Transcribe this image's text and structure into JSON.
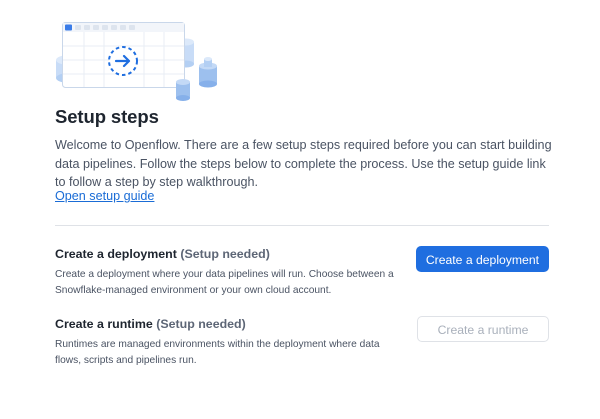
{
  "header": {
    "title": "Setup steps",
    "intro": "Welcome to Openflow. There are a few setup steps required before you can start building data pipelines. Follow the steps below to complete the process. Use the setup guide link to follow a step by step walkthrough.",
    "guide_link": "Open setup guide"
  },
  "illustration": {
    "icons": [
      "browser-window-icon",
      "arrow-right-icon",
      "database-icon"
    ],
    "colors": {
      "accent": "#1f6ee0",
      "light_blue": "#c8dcf7",
      "mid_blue": "#9dc0ee"
    }
  },
  "steps": [
    {
      "title": "Create a deployment",
      "status": "(Setup needed)",
      "description": "Create a deployment where your data pipelines will run. Choose between a Snowflake-managed environment or your own cloud account.",
      "button": "Create a deployment",
      "button_enabled": true
    },
    {
      "title": "Create a runtime",
      "status": "(Setup needed)",
      "description": "Runtimes are managed environments within the deployment where data flows, scripts and pipelines run.",
      "button": "Create a runtime",
      "button_enabled": false
    }
  ],
  "colors": {
    "primary_button": "#1f6ee0",
    "link": "#1a6cd6",
    "text": "#1e252f",
    "muted_text": "#4a5363",
    "divider": "#dfe2e7"
  }
}
